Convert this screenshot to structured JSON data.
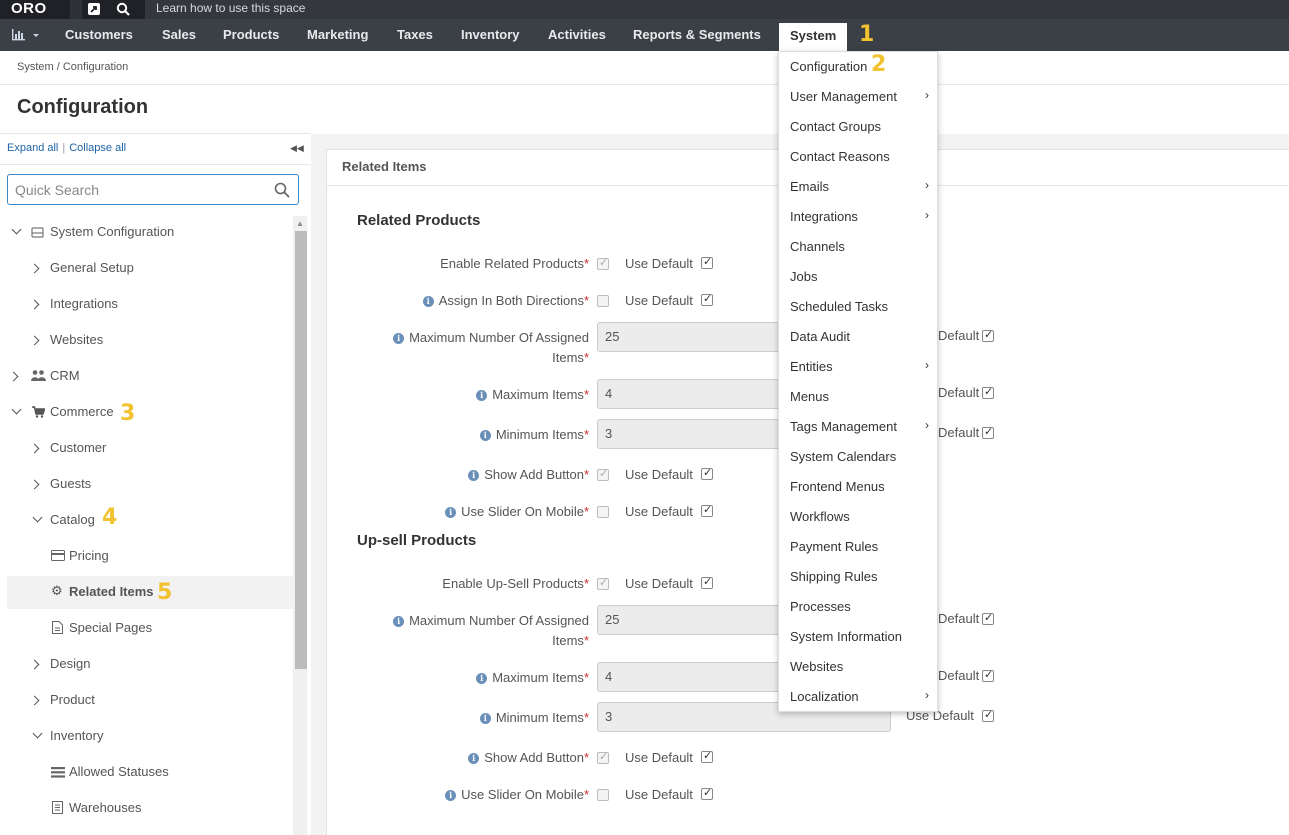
{
  "topbar": {
    "logo": "ORO",
    "hint": "Learn how to use this space"
  },
  "nav": {
    "items": [
      "Customers",
      "Sales",
      "Products",
      "Marketing",
      "Taxes",
      "Inventory",
      "Activities",
      "Reports & Segments",
      "System"
    ]
  },
  "markers": [
    "1",
    "2",
    "3",
    "4",
    "5"
  ],
  "breadcrumb": "System / Configuration",
  "page_title": "Configuration",
  "sidebar": {
    "expand_all": "Expand all",
    "separator": "|",
    "collapse_all": "Collapse all",
    "search_placeholder": "Quick Search",
    "items": [
      "System Configuration",
      "General Setup",
      "Integrations",
      "Websites",
      "CRM",
      "Commerce",
      "Customer",
      "Guests",
      "Catalog",
      "Pricing",
      "Related Items",
      "Special Pages",
      "Design",
      "Product",
      "Inventory",
      "Allowed Statuses",
      "Warehouses"
    ]
  },
  "main": {
    "panel_title": "Related Items",
    "use_default": "Use Default",
    "default_partial": "Default",
    "sections": [
      {
        "title": "Related Products",
        "fields": [
          {
            "label": "Enable Related Products",
            "info": false,
            "type": "checkbox",
            "checked": true
          },
          {
            "label": "Assign In Both Directions",
            "info": true,
            "type": "checkbox",
            "checked": false
          },
          {
            "label": "Maximum Number Of Assigned",
            "label2": "Items",
            "info": true,
            "type": "text",
            "value": "25"
          },
          {
            "label": "Maximum Items",
            "info": true,
            "type": "text",
            "value": "4"
          },
          {
            "label": "Minimum Items",
            "info": true,
            "type": "text",
            "value": "3"
          },
          {
            "label": "Show Add Button",
            "info": true,
            "type": "checkbox",
            "checked": true
          },
          {
            "label": "Use Slider On Mobile",
            "info": true,
            "type": "checkbox",
            "checked": false
          }
        ]
      },
      {
        "title": "Up-sell Products",
        "fields": [
          {
            "label": "Enable Up-Sell Products",
            "info": false,
            "type": "checkbox",
            "checked": true
          },
          {
            "label": "Maximum Number Of Assigned",
            "label2": "Items",
            "info": true,
            "type": "text",
            "value": "25"
          },
          {
            "label": "Maximum Items",
            "info": true,
            "type": "text",
            "value": "4"
          },
          {
            "label": "Minimum Items",
            "info": true,
            "type": "text",
            "value": "3"
          },
          {
            "label": "Show Add Button",
            "info": true,
            "type": "checkbox",
            "checked": true
          },
          {
            "label": "Use Slider On Mobile",
            "info": true,
            "type": "checkbox",
            "checked": false
          }
        ]
      }
    ]
  },
  "system_menu": {
    "items": [
      "Configuration",
      "User Management",
      "Contact Groups",
      "Contact Reasons",
      "Emails",
      "Integrations",
      "Channels",
      "Jobs",
      "Scheduled Tasks",
      "Data Audit",
      "Entities",
      "Menus",
      "Tags Management",
      "System Calendars",
      "Frontend Menus",
      "Workflows",
      "Payment Rules",
      "Shipping Rules",
      "Processes",
      "System Information",
      "Websites",
      "Localization"
    ],
    "submenu_items": [
      "User Management",
      "Emails",
      "Integrations",
      "Entities",
      "Tags Management",
      "Localization"
    ]
  },
  "colors": {
    "accent": "#f2c230",
    "link": "#1e63a7",
    "nav_bg": "#3b3f46",
    "topbar_bg": "#1f2126",
    "required": "#c9302c"
  }
}
